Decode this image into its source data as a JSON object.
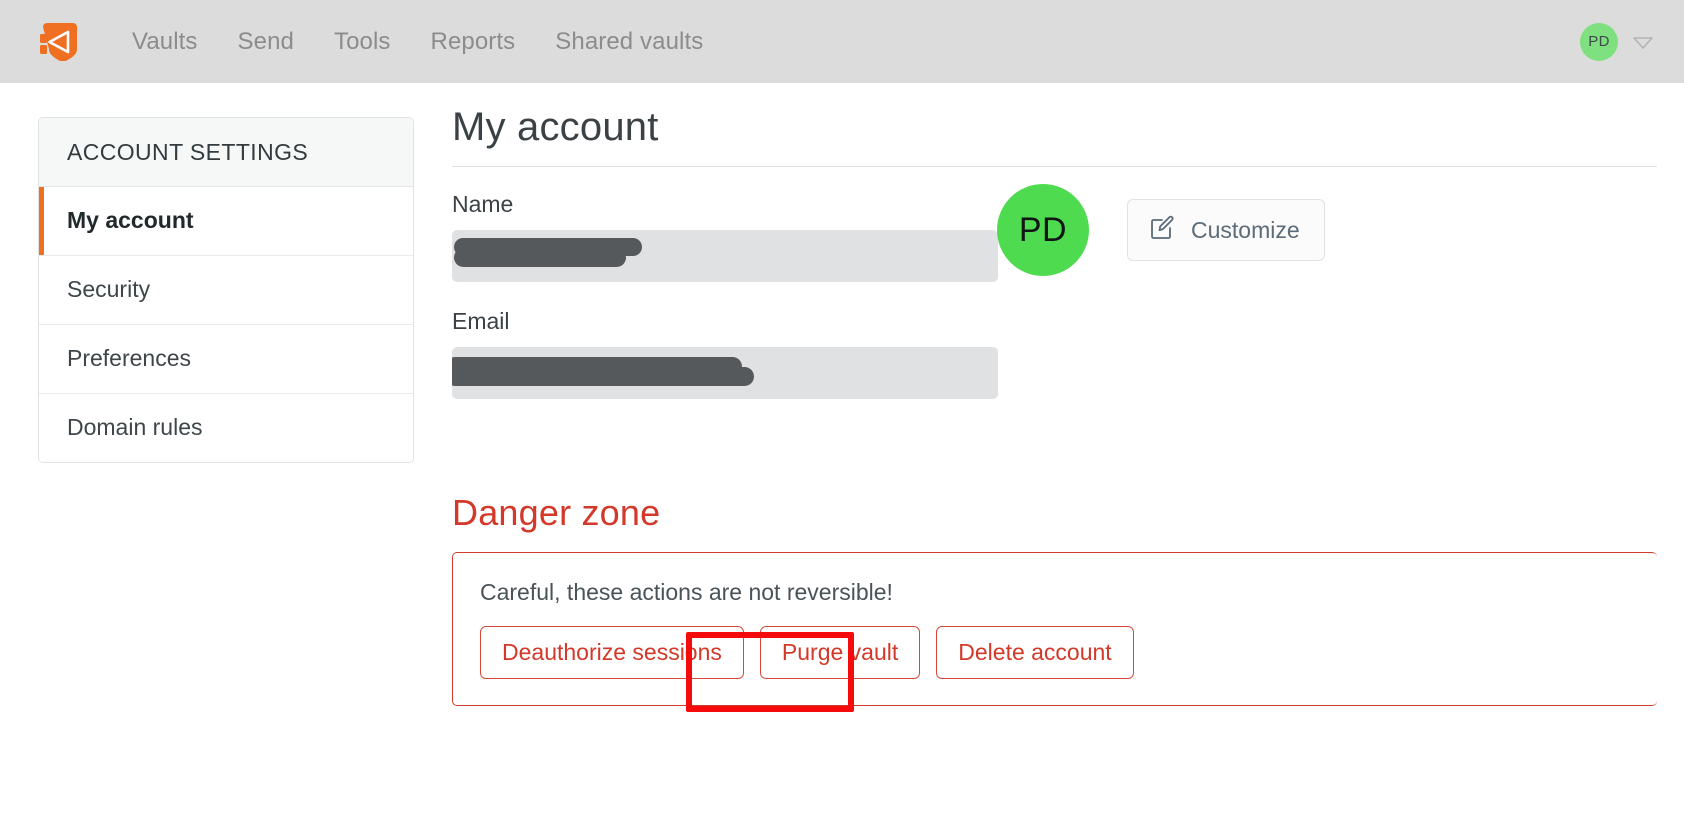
{
  "topbar": {
    "logo_name": "padloc-logo",
    "logo_color": "#ef7023",
    "nav_items": [
      {
        "label": "Vaults"
      },
      {
        "label": "Send"
      },
      {
        "label": "Tools"
      },
      {
        "label": "Reports"
      },
      {
        "label": "Shared vaults"
      }
    ],
    "avatar_initials": "PD",
    "avatar_color": "#7ee07e",
    "chevron_icon": "chevron-down-icon"
  },
  "sidebar": {
    "header": "ACCOUNT SETTINGS",
    "active_color": "#ef7023",
    "items": [
      {
        "label": "My account",
        "active": true
      },
      {
        "label": "Security",
        "active": false
      },
      {
        "label": "Preferences",
        "active": false
      },
      {
        "label": "Domain rules",
        "active": false
      }
    ]
  },
  "main": {
    "title": "My account",
    "name_label": "Name",
    "name_value": "",
    "name_placeholder": "Name",
    "email_label": "Email",
    "email_value": "",
    "email_placeholder": "Email",
    "avatar_initials": "PD",
    "avatar_color": "#4fdb4f",
    "customize_label": "Customize",
    "customize_icon": "edit-square-pencil-icon"
  },
  "danger_zone": {
    "title": "Danger zone",
    "title_color": "#d3382a",
    "note": "Careful, these actions are not reversible!",
    "buttons": [
      {
        "label": "Deauthorize sessions"
      },
      {
        "label": "Purge vault",
        "highlighted": true
      },
      {
        "label": "Delete account"
      }
    ],
    "border_color": "#cf3b2c"
  },
  "annotation": {
    "name": "purge-vault-highlight",
    "color": "#f50b0b",
    "targets": "Purge vault"
  }
}
